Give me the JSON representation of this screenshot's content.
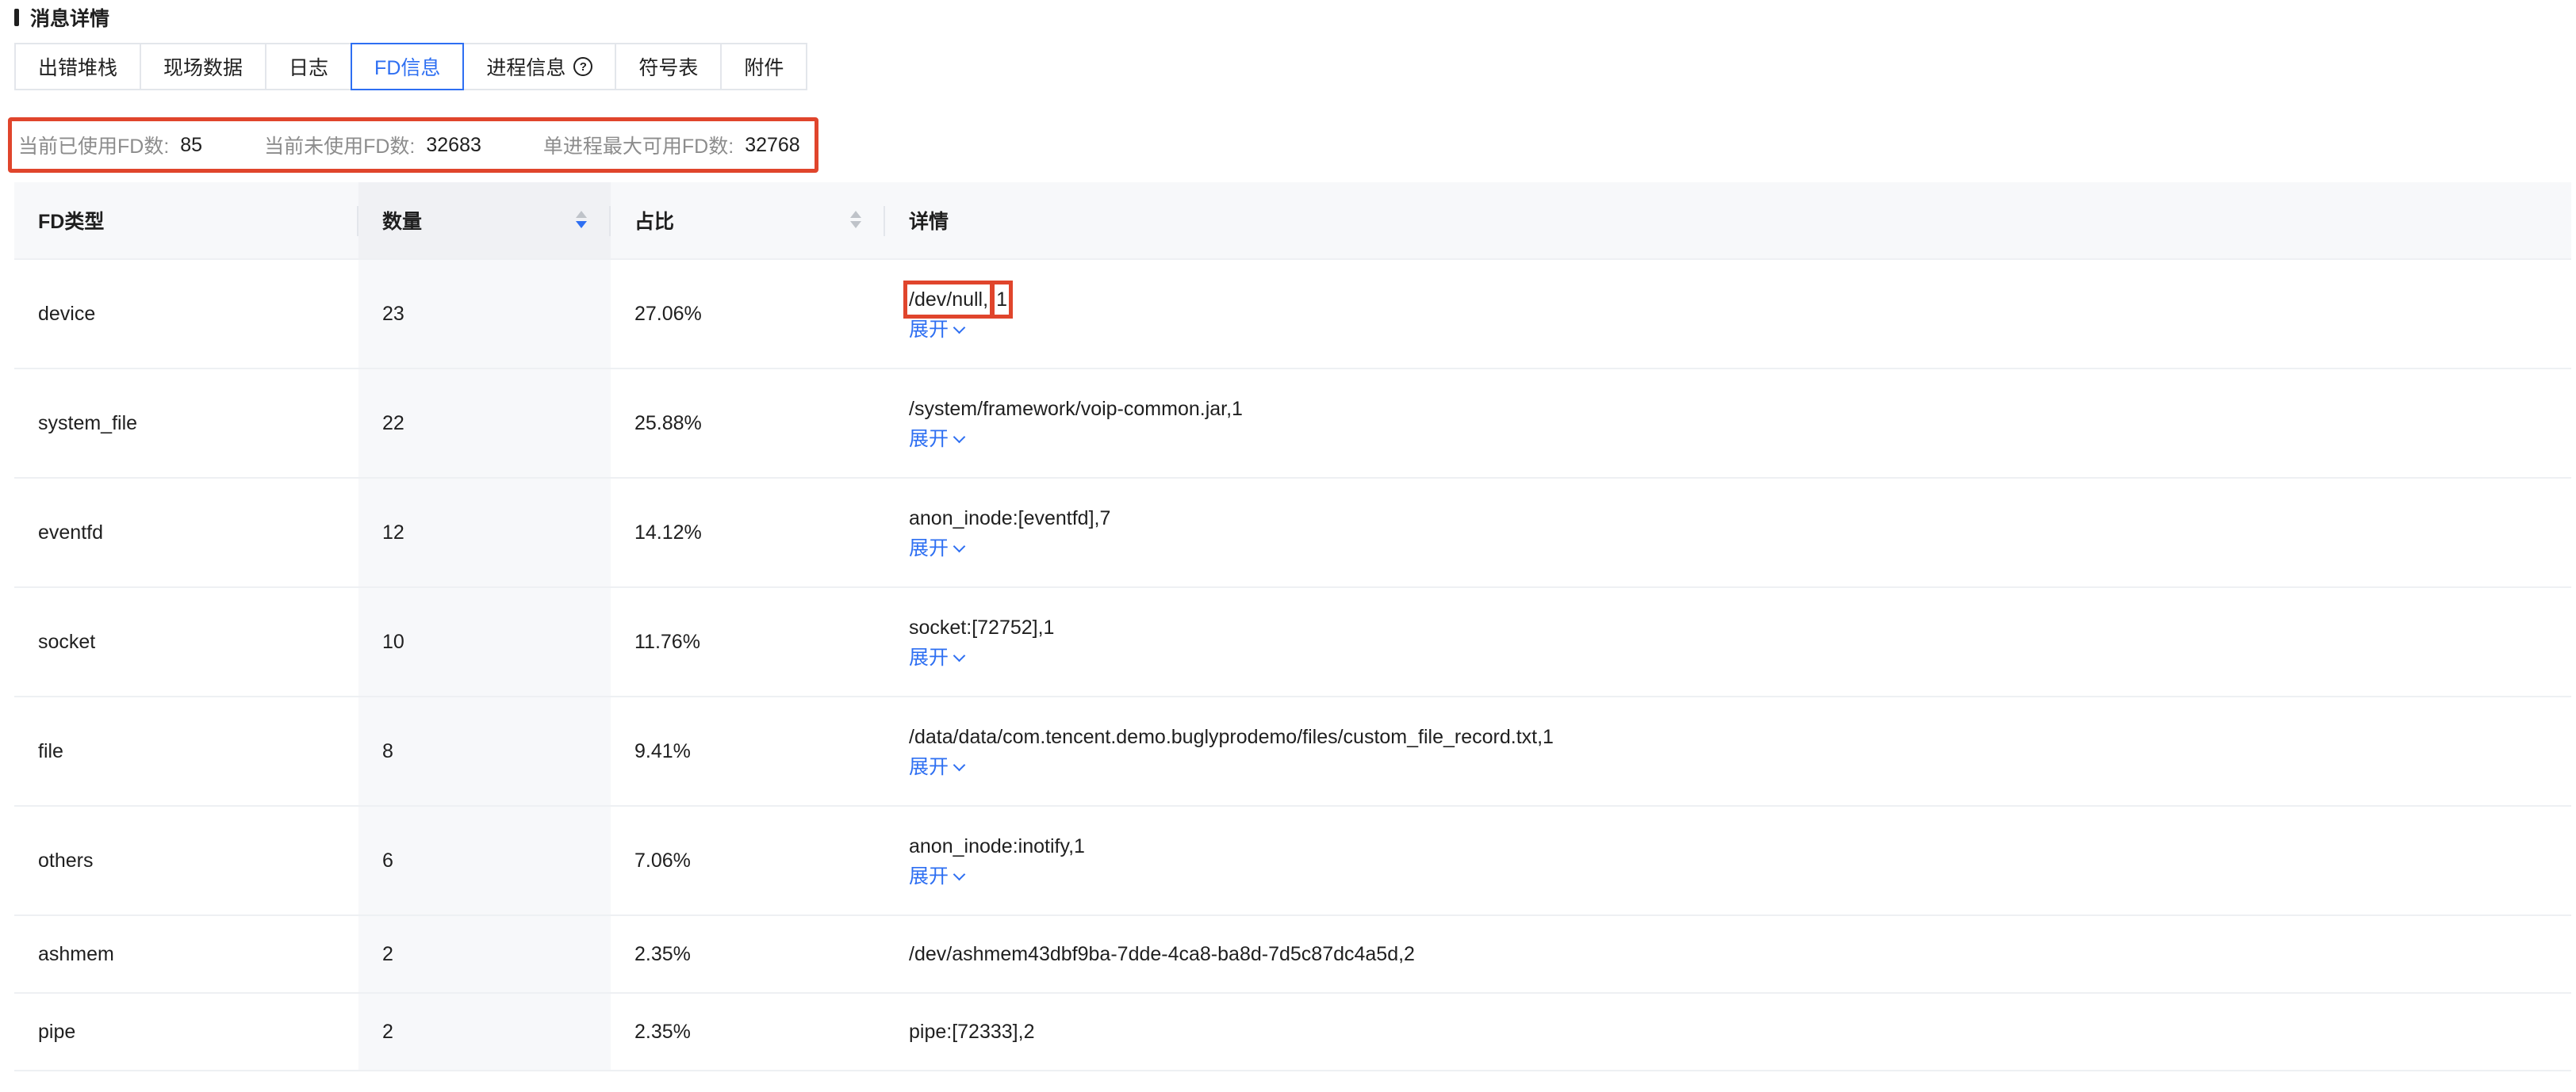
{
  "section": {
    "title": "消息详情"
  },
  "tabs": [
    {
      "label": "出错堆栈"
    },
    {
      "label": "现场数据"
    },
    {
      "label": "日志"
    },
    {
      "label": "FD信息"
    },
    {
      "label": "进程信息"
    },
    {
      "label": "符号表"
    },
    {
      "label": "附件"
    }
  ],
  "active_tab": "FD信息",
  "stats": {
    "used_label": "当前已使用FD数:",
    "used_value": "85",
    "unused_label": "当前未使用FD数:",
    "unused_value": "32683",
    "max_label": "单进程最大可用FD数:",
    "max_value": "32768"
  },
  "table": {
    "headers": {
      "type": "FD类型",
      "count": "数量",
      "ratio": "占比",
      "detail": "详情"
    },
    "sorted_column": "数量",
    "sort_direction": "descending",
    "expand_label": "展开",
    "rows": [
      {
        "type": "device",
        "count": "23",
        "ratio": "27.06%",
        "detail_a": "/dev/null",
        "detail_b": "1",
        "expandable": true
      },
      {
        "type": "system_file",
        "count": "22",
        "ratio": "25.88%",
        "detail": "/system/framework/voip-common.jar,1",
        "expandable": true
      },
      {
        "type": "eventfd",
        "count": "12",
        "ratio": "14.12%",
        "detail": "anon_inode:[eventfd],7",
        "expandable": true
      },
      {
        "type": "socket",
        "count": "10",
        "ratio": "11.76%",
        "detail": "socket:[72752],1",
        "expandable": true
      },
      {
        "type": "file",
        "count": "8",
        "ratio": "9.41%",
        "detail": "/data/data/com.tencent.demo.buglyprodemo/files/custom_file_record.txt,1",
        "expandable": true
      },
      {
        "type": "others",
        "count": "6",
        "ratio": "7.06%",
        "detail": "anon_inode:inotify,1",
        "expandable": true
      },
      {
        "type": "ashmem",
        "count": "2",
        "ratio": "2.35%",
        "detail": "/dev/ashmem43dbf9ba-7dde-4ca8-ba8d-7d5c87dc4a5d,2",
        "expandable": false
      },
      {
        "type": "pipe",
        "count": "2",
        "ratio": "2.35%",
        "detail": "pipe:[72333],2",
        "expandable": false
      }
    ]
  },
  "colors": {
    "accent": "#2e6ff2",
    "highlight_box": "#e0452c",
    "muted_text": "#8c8c8c"
  }
}
